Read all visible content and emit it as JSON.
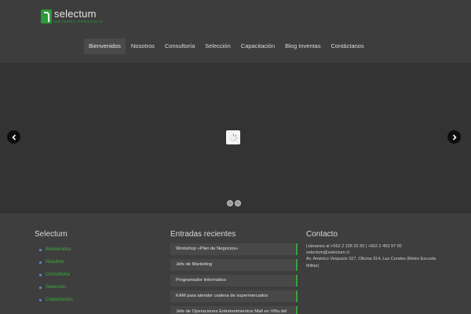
{
  "brand": {
    "name": "selectum",
    "tagline": "MEJORES PERSONAS",
    "accent_color": "#2e9a3a"
  },
  "nav": {
    "items": [
      {
        "label": "Bienvenidos",
        "active": true
      },
      {
        "label": "Nosotros"
      },
      {
        "label": "Consultoría"
      },
      {
        "label": "Selección"
      },
      {
        "label": "Capacitación"
      },
      {
        "label": "Blog Inventas"
      },
      {
        "label": "Contáctanos"
      }
    ]
  },
  "slider": {
    "prev_icon": "chevron-left-icon",
    "next_icon": "chevron-right-icon",
    "loader_icon": "spinner-icon",
    "dot_count": 2
  },
  "footer": {
    "col1": {
      "title": "Selectum",
      "items": [
        "Bienvenidos",
        "Nosotros",
        "Consultoría",
        "Selección",
        "Capacitación"
      ]
    },
    "col2": {
      "title": "Entradas recientes",
      "items": [
        "Workshop «Plan de Negocios»",
        "Jefe de Marketing",
        "Programador Informático",
        "KAM para atender cadena de supermercados",
        "Jefe de Operaciones Entretenimientos Mall en Viña del"
      ]
    },
    "col3": {
      "title": "Contacto",
      "phone": "Llámanos al +562 2 228 20 30 | +562 2 453 97 00",
      "email": "selectum@selectum.cl",
      "address": "Av. Américo Vespucio 107, Oficina 314, Las Condes (Metro Escuela Militar)"
    }
  }
}
